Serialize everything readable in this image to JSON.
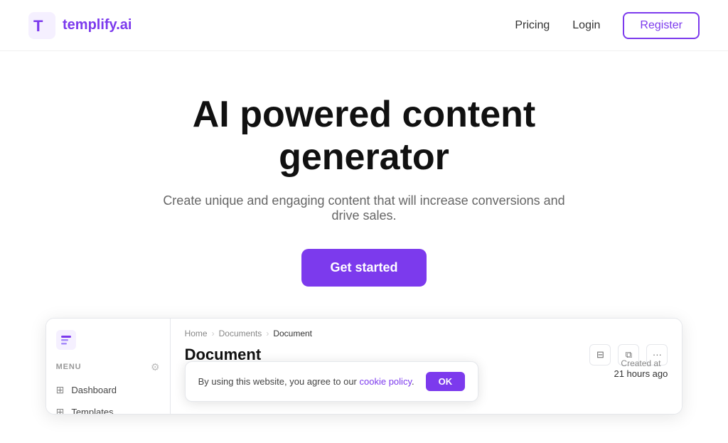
{
  "header": {
    "logo_text": "templify.ai",
    "nav": {
      "pricing_label": "Pricing",
      "login_label": "Login",
      "register_label": "Register"
    }
  },
  "hero": {
    "title": "AI powered content generator",
    "subtitle": "Create unique and engaging content that will increase conversions and drive sales.",
    "cta_label": "Get started"
  },
  "preview": {
    "sidebar": {
      "menu_label": "MENU",
      "items": [
        {
          "label": "Dashboard"
        },
        {
          "label": "Templates"
        }
      ]
    },
    "breadcrumbs": [
      {
        "label": "Home"
      },
      {
        "label": "Documents"
      },
      {
        "label": "Document"
      }
    ],
    "doc_title": "Document",
    "created_at_label": "Created at",
    "created_at_time": "21 hours ago"
  },
  "cookie": {
    "text": "By using this website, you agree to our",
    "link_text": "cookie policy",
    "period": ".",
    "ok_label": "OK"
  }
}
